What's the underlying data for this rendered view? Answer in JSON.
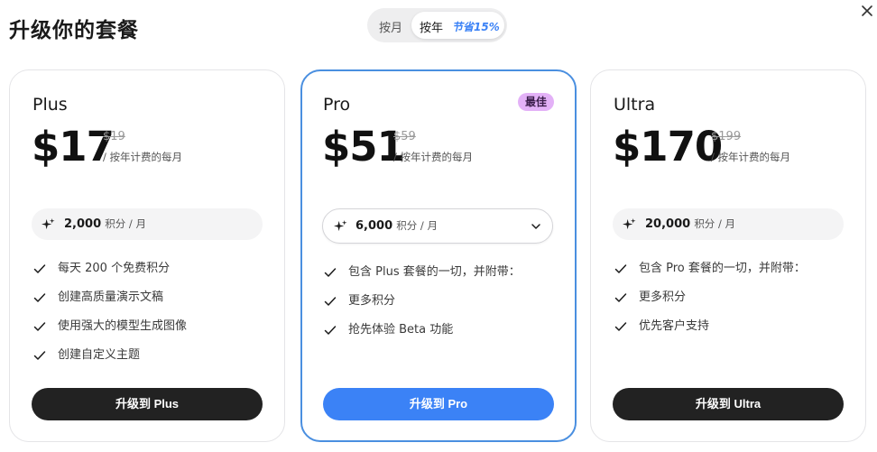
{
  "dialog": {
    "title": "升级你的套餐"
  },
  "billing_toggle": {
    "monthly_label": "按月",
    "yearly_label": "按年",
    "yearly_savings": "节省15%",
    "selected": "yearly"
  },
  "plans": [
    {
      "name": "Plus",
      "price": "$17",
      "original_price": "$19",
      "period_note": "/ 按年计费的每月",
      "credits_amount": "2,000",
      "credits_unit": "积分 / 月",
      "features": [
        "每天 200 个免费积分",
        "创建高质量演示文稿",
        "使用强大的模型生成图像",
        "创建自定义主题"
      ],
      "cta_label": "升级到 Plus"
    },
    {
      "name": "Pro",
      "badge": "最佳",
      "price": "$51",
      "original_price": "$59",
      "period_note": "/ 按年计费的每月",
      "credits_amount": "6,000",
      "credits_unit": "积分 / 月",
      "features": [
        "包含 Plus 套餐的一切，并附带：",
        "更多积分",
        "抢先体验 Beta 功能"
      ],
      "cta_label": "升级到 Pro"
    },
    {
      "name": "Ultra",
      "price": "$170",
      "original_price": "$199",
      "period_note": "/ 按年计费的每月",
      "credits_amount": "20,000",
      "credits_unit": "积分 / 月",
      "features": [
        "包含 Pro 套餐的一切，并附带：",
        "更多积分",
        "优先客户支持"
      ],
      "cta_label": "升级到 Ultra"
    }
  ],
  "icons": {
    "close": "close-icon",
    "sparkle": "sparkle-icon",
    "check": "check-icon",
    "chevron": "chevron-down-icon"
  },
  "colors": {
    "accent": "#3b82f6",
    "badge_bg": "#e3b1f7",
    "dark_button": "#222222"
  }
}
